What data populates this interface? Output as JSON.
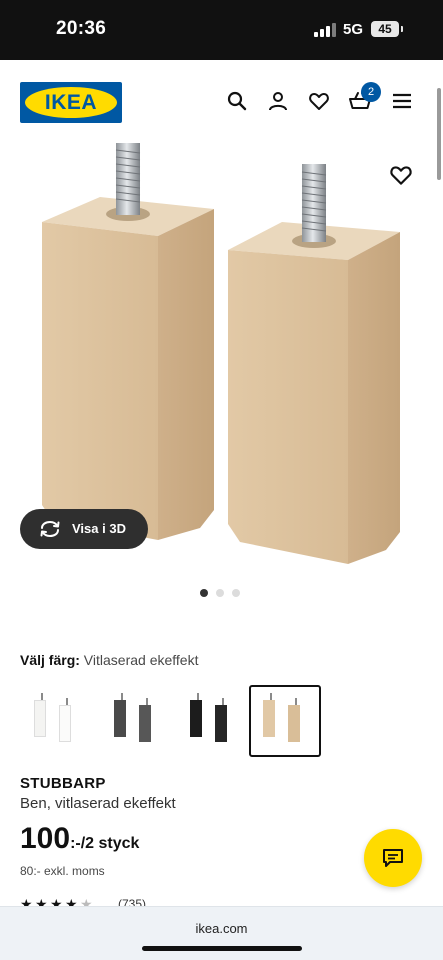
{
  "status_bar": {
    "time": "20:36",
    "network": "5G",
    "battery": "45"
  },
  "header": {
    "logo_text": "IKEA",
    "icons": [
      "search-icon",
      "account-icon",
      "heart-icon",
      "basket-icon",
      "menu-icon"
    ],
    "cart_count": "2"
  },
  "gallery": {
    "view3d_label": "Visa i 3D",
    "dots_total": 3,
    "dots_active": 1
  },
  "color_selection": {
    "label": "Välj färg:",
    "value": "Vitlaserad ekeffekt",
    "options": [
      "white",
      "dark-grey",
      "black",
      "white-stained-oak"
    ],
    "selected_index": 3
  },
  "product": {
    "name": "STUBBARP",
    "description": "Ben, vitlaserad ekeffekt",
    "price_main": "100",
    "price_suffix": ":-/2 styck",
    "price_excl_vat": "80:- exkl. moms",
    "rating": 4.5,
    "review_count": "(735)"
  },
  "browser": {
    "url": "ikea.com"
  },
  "colors": {
    "brand_blue": "#0058a3",
    "brand_yellow": "#ffdb00",
    "wood": "#dcc3a2"
  }
}
